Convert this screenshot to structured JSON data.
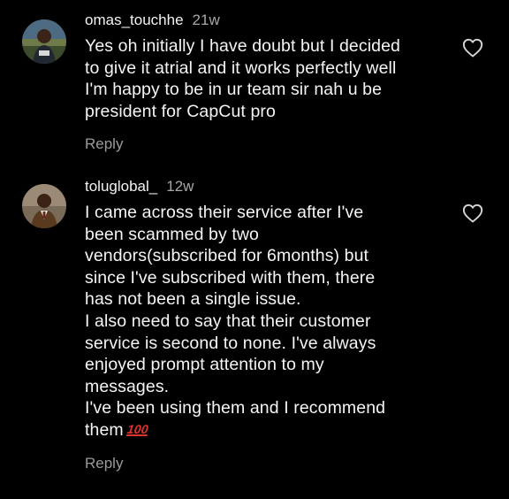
{
  "comments": [
    {
      "username": "omas_touchhe",
      "timestamp": "21w",
      "text": "Yes oh initially I have doubt but I decided\nto give it atrial and it works perfectly well\nI'm happy to be in ur team sir nah u be\npresident for CapCut pro",
      "reply_label": "Reply",
      "like_icon": "heart-outline-icon",
      "avatar_icon": "user-avatar-photo"
    },
    {
      "username": "toluglobal_",
      "timestamp": "12w",
      "text": "I came across their service after I've\nbeen scammed by two\nvendors(subscribed for 6months) but\nsince I've subscribed with them, there\nhas not been a single issue.\nI also need to say that their customer\nservice is second to none. I've always\nenjoyed prompt attention to my\nmessages.\nI've been using them and I recommend\nthem",
      "emoji": "100",
      "emoji_icon": "hundred-points-emoji",
      "reply_label": "Reply",
      "like_icon": "heart-outline-icon",
      "avatar_icon": "user-avatar-photo"
    }
  ],
  "colors": {
    "background": "#000000",
    "text": "#f5f5f5",
    "muted": "#a8a8a8",
    "emoji_red": "#e0322e"
  }
}
